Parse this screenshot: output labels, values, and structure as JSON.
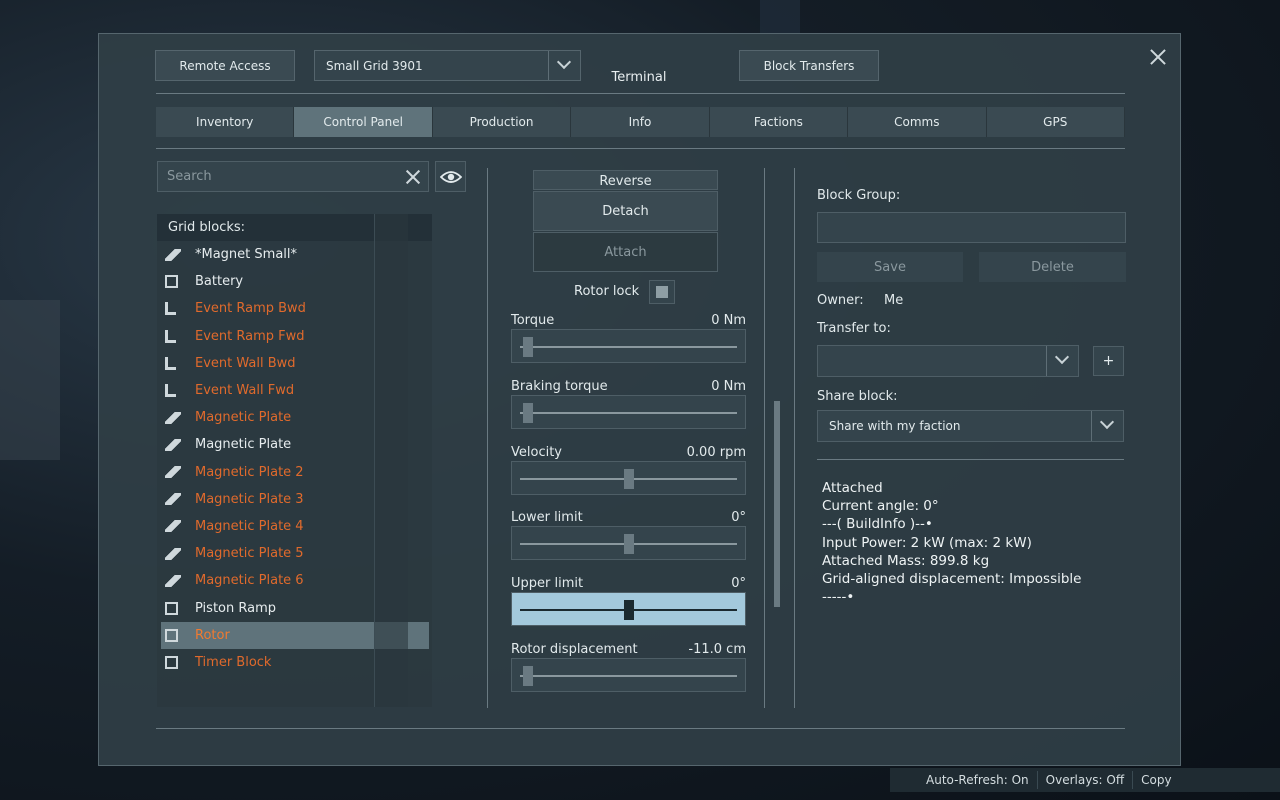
{
  "header": {
    "title": "Terminal",
    "remote_access": "Remote Access",
    "grid_name": "Small Grid 3901",
    "block_transfers": "Block Transfers"
  },
  "tabs": [
    {
      "label": "Inventory"
    },
    {
      "label": "Control Panel"
    },
    {
      "label": "Production"
    },
    {
      "label": "Info"
    },
    {
      "label": "Factions"
    },
    {
      "label": "Comms"
    },
    {
      "label": "GPS"
    }
  ],
  "search": {
    "placeholder": "Search"
  },
  "blocks": {
    "header": "Grid blocks:",
    "items": [
      {
        "label": "*Magnet Small*",
        "icon": "plate-icon"
      },
      {
        "label": "Battery",
        "icon": "box-icon"
      },
      {
        "label": "Event Ramp Bwd",
        "icon": "ramp-icon"
      },
      {
        "label": "Event Ramp Fwd",
        "icon": "ramp-icon"
      },
      {
        "label": "Event Wall Bwd",
        "icon": "ramp-icon"
      },
      {
        "label": "Event Wall Fwd",
        "icon": "ramp-icon"
      },
      {
        "label": "Magnetic Plate",
        "icon": "plate-icon"
      },
      {
        "label": "Magnetic Plate",
        "icon": "plate-icon"
      },
      {
        "label": "Magnetic Plate 2",
        "icon": "plate-icon"
      },
      {
        "label": "Magnetic Plate 3",
        "icon": "plate-icon"
      },
      {
        "label": "Magnetic Plate 4",
        "icon": "plate-icon"
      },
      {
        "label": "Magnetic Plate 5",
        "icon": "plate-icon"
      },
      {
        "label": "Magnetic Plate 6",
        "icon": "plate-icon"
      },
      {
        "label": "Piston Ramp",
        "icon": "box-icon"
      },
      {
        "label": "Rotor",
        "icon": "box-icon"
      },
      {
        "label": "Timer Block",
        "icon": "box-icon"
      }
    ]
  },
  "controls": {
    "reverse": "Reverse",
    "detach": "Detach",
    "attach": "Attach",
    "rotor_lock": "Rotor lock",
    "torque_label": "Torque",
    "torque_value": "0 Nm",
    "braking_label": "Braking torque",
    "braking_value": "0 Nm",
    "velocity_label": "Velocity",
    "velocity_value": "0.00 rpm",
    "lower_label": "Lower limit",
    "lower_value": "0°",
    "upper_label": "Upper limit",
    "upper_value": "0°",
    "displacement_label": "Rotor displacement",
    "displacement_value": "-11.0 cm"
  },
  "right": {
    "block_group_label": "Block Group:",
    "save": "Save",
    "delete": "Delete",
    "owner_label": "Owner:",
    "owner_value": "Me",
    "transfer_label": "Transfer to:",
    "plus": "+",
    "share_label": "Share block:",
    "share_value": "Share with my faction",
    "info": "Attached\nCurrent angle: 0°\n---( BuildInfo )--•\nInput Power: 2 kW (max: 2 kW)\nAttached Mass: 899.8 kg\nGrid-aligned displacement: Impossible\n-----•"
  },
  "status": {
    "auto_refresh": "Auto-Refresh: On",
    "overlays": "Overlays: Off",
    "copy": "Copy"
  }
}
